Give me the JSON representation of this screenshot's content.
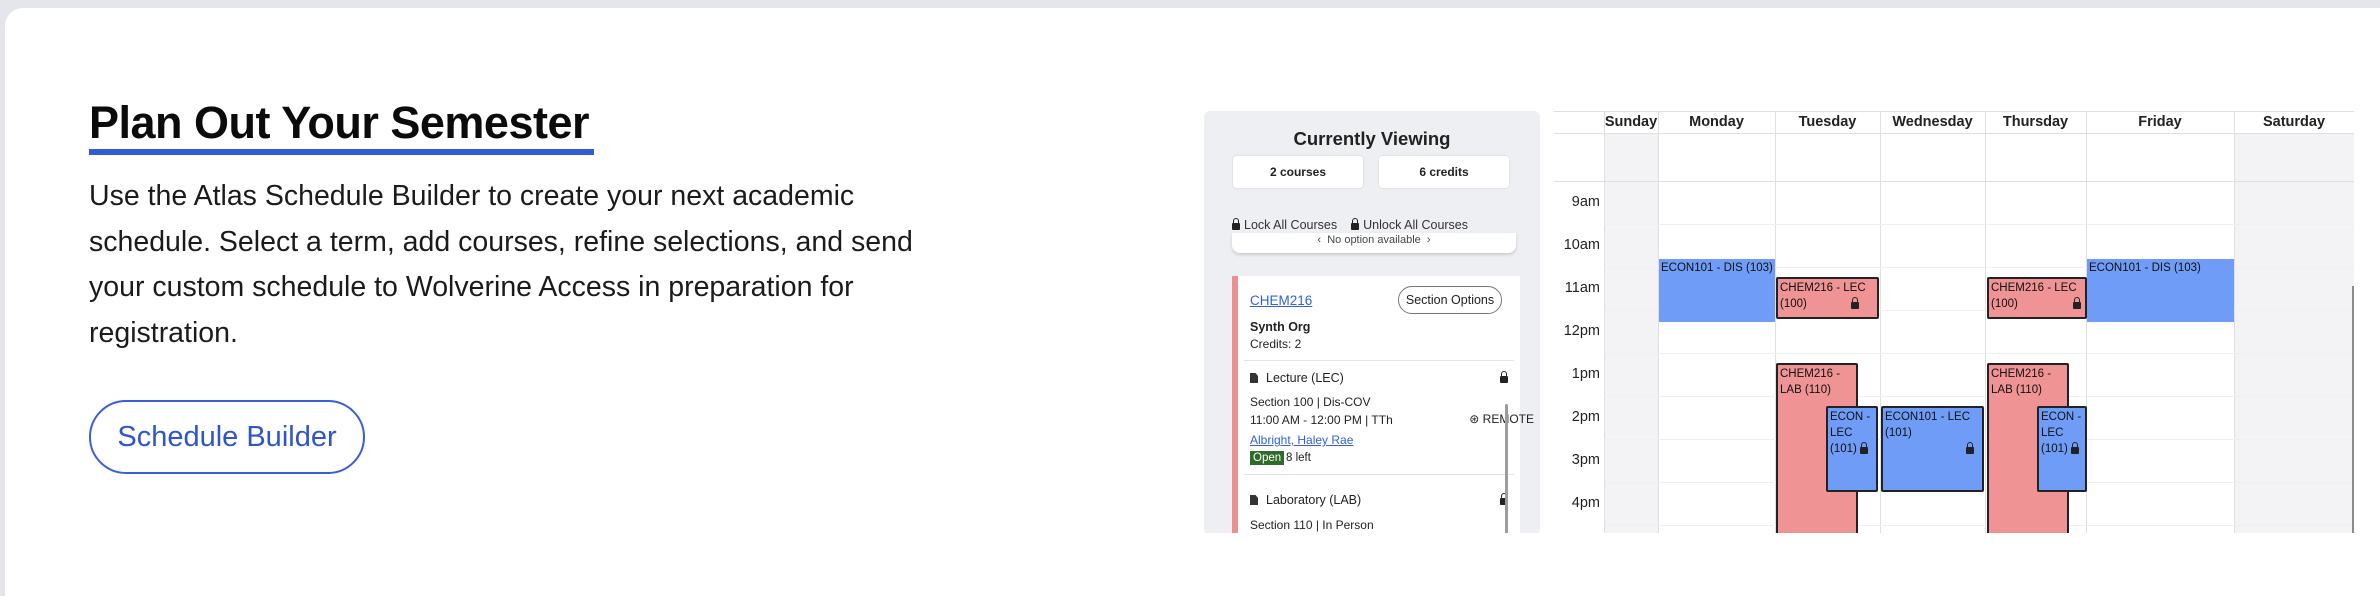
{
  "hero": {
    "title": "Plan Out Your Semester",
    "description": "Use the Atlas Schedule Builder to create your next academic schedule. Select a term, add courses, refine selections, and send your custom schedule to Wolverine Access in preparation for registration.",
    "cta_label": "Schedule Builder"
  },
  "panel": {
    "title": "Currently Viewing",
    "courses": "2 courses",
    "credits": "6 credits",
    "lock_all": "Lock All Courses",
    "unlock_all": "Unlock All Courses",
    "no_option": "No option available",
    "course": {
      "code": "CHEM216",
      "section_options": "Section Options",
      "org": "Synth Org",
      "credits": "Credits: 2",
      "components": [
        {
          "label": "Lecture (LEC)",
          "section": "Section 100 | Dis-COV",
          "time": "11:00 AM - 12:00 PM | TTh",
          "remote": "REMOTE",
          "instructor": "Albright, Haley Rae",
          "status": "Open",
          "seats": "8 left"
        },
        {
          "label": "Laboratory (LAB)",
          "section": "Section 110 | In Person"
        }
      ]
    }
  },
  "calendar": {
    "days": [
      "Sunday",
      "Monday",
      "Tuesday",
      "Wednesday",
      "Thursday",
      "Friday",
      "Saturday"
    ],
    "times": [
      "9am",
      "10am",
      "11am",
      "12pm",
      "1pm",
      "2pm",
      "3pm",
      "4pm"
    ],
    "events": {
      "mon_econ": "ECON101 - DIS (103)",
      "tue_chem_lec": "CHEM216 - LEC (100)",
      "tue_chem_lab": "CHEM216 - LAB (110)",
      "tue_econ_lec": "ECON - LEC (101)",
      "wed_econ_lec": "ECON101 - LEC (101)",
      "thu_chem_lec": "CHEM216 - LEC (100)",
      "thu_chem_lab": "CHEM216 - LAB (110)",
      "thu_econ_lec": "ECON - LEC (101)",
      "fri_econ": "ECON101 - DIS (103)"
    }
  },
  "colors": {
    "accent": "#2f5bd3",
    "event_blue": "#6f9cf6",
    "event_red": "#ef9394",
    "open_green": "#2f6b2a"
  }
}
